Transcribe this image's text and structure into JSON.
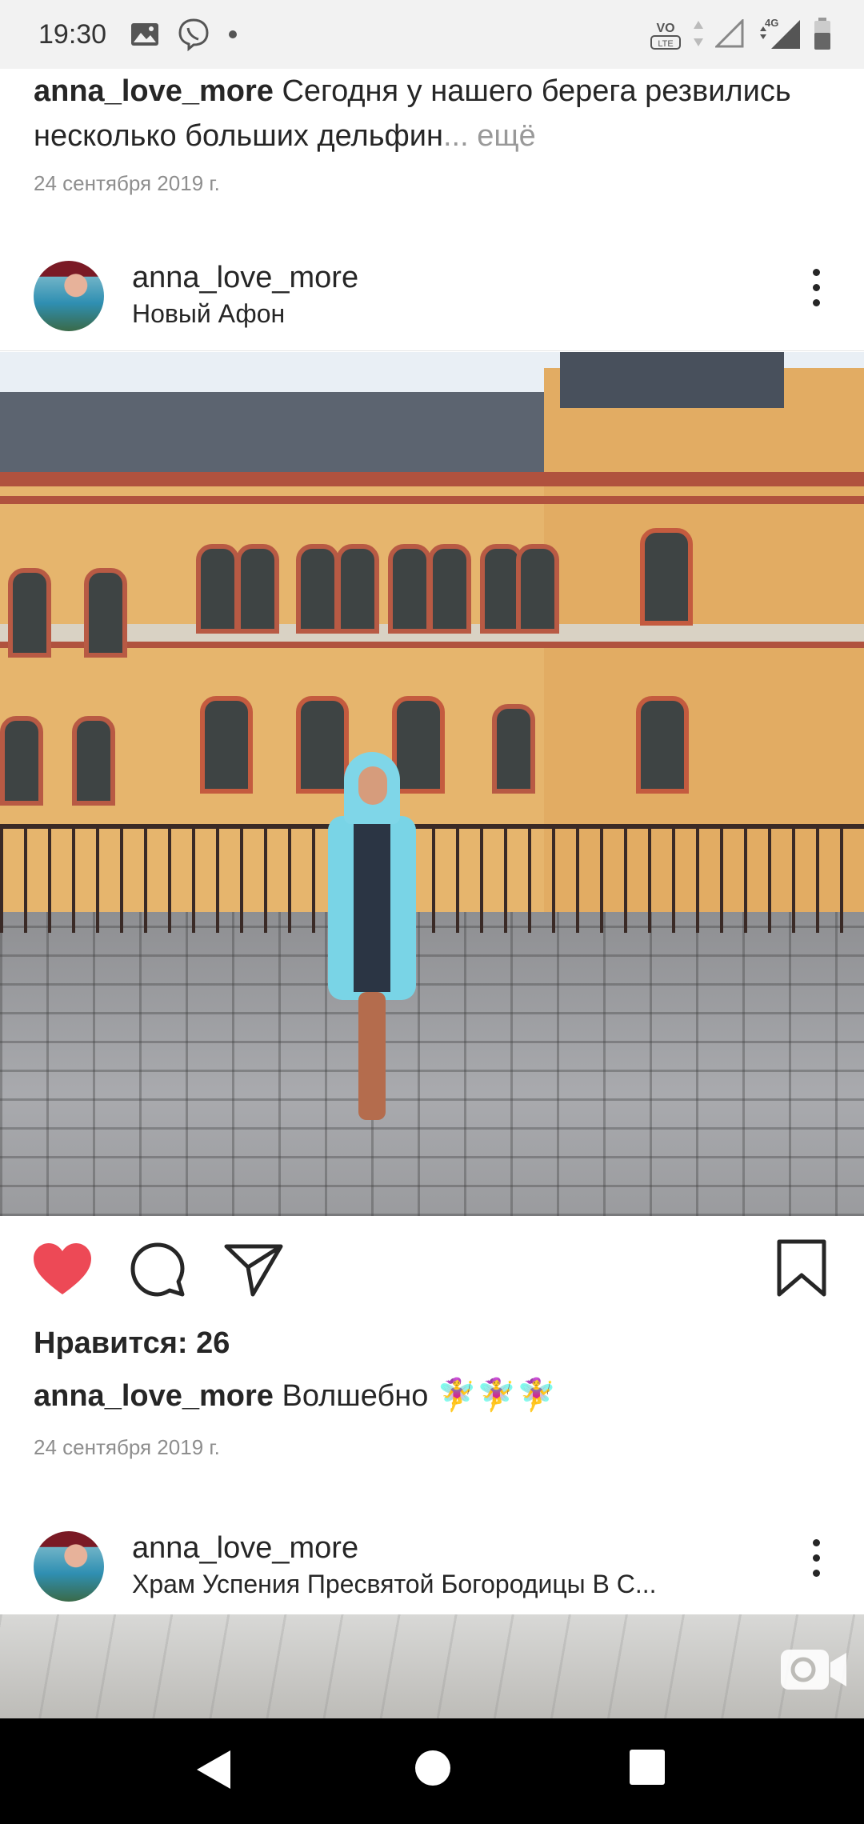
{
  "status_bar": {
    "time": "19:30",
    "icons_left": [
      "gallery-icon",
      "viber-icon",
      "notification-dot-icon"
    ],
    "icons_right": [
      "volte-icon",
      "data-arrows-icon",
      "signal-weak-icon",
      "4g-signal-icon",
      "battery-icon"
    ],
    "network_label": "4G",
    "volte_label": "VO LTE"
  },
  "previous_post": {
    "username": "anna_love_more",
    "caption": "Сегодня у нашего берега резвились несколько больших дельфин",
    "more": "... ещё",
    "date": "24 сентября 2019 г."
  },
  "post": {
    "username": "anna_love_more",
    "location": "Новый Афон",
    "liked": true,
    "like_color": "#ed4956",
    "likes_text": "Нравится: 26",
    "caption_user": "anna_love_more",
    "caption_text": "Волшебно",
    "caption_emoji": "🧚‍♀️🧚‍♀️🧚‍♀️",
    "date": "24 сентября 2019 г."
  },
  "next_post": {
    "username": "anna_love_more",
    "location": "Храм Успения Пресвятой Богородицы В С..."
  }
}
